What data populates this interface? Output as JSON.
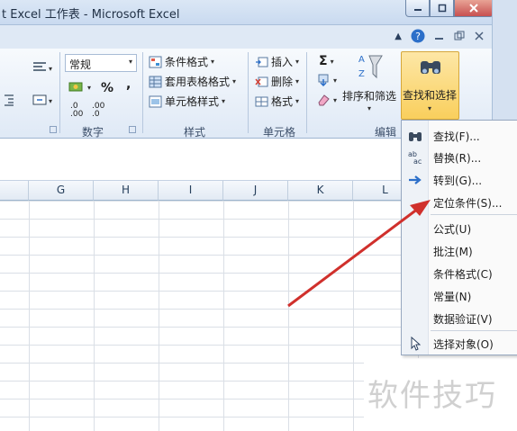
{
  "window": {
    "title": "t Excel 工作表 - Microsoft Excel"
  },
  "ribbon": {
    "number_format": "常规",
    "percent_symbol": "%",
    "comma_symbol": ",",
    "decimal_increase": ".0 .00",
    "decimal_decrease": ".00 .0",
    "groups": {
      "number": "数字",
      "styles": "样式",
      "cells": "单元格",
      "editing": "编辑"
    },
    "styles": {
      "conditional_format": "条件格式",
      "table_format": "套用表格格式",
      "cell_styles": "单元格样式"
    },
    "cells": {
      "insert": "插入",
      "delete": "删除",
      "format": "格式"
    },
    "editing": {
      "autosum": "Σ",
      "sort_filter": "排序和筛选",
      "find_select": "查找和选择"
    }
  },
  "sheet": {
    "columns": [
      "G",
      "H",
      "I",
      "J",
      "K",
      "L"
    ]
  },
  "menu": {
    "items": [
      {
        "label": "查找(F)...",
        "icon": "binoculars-icon"
      },
      {
        "label": "替换(R)...",
        "icon": "replace-icon"
      },
      {
        "label": "转到(G)...",
        "icon": "arrow-right-icon"
      },
      {
        "label": "定位条件(S)...",
        "icon": ""
      },
      {
        "label": "公式(U)",
        "icon": ""
      },
      {
        "label": "批注(M)",
        "icon": ""
      },
      {
        "label": "条件格式(C)",
        "icon": ""
      },
      {
        "label": "常量(N)",
        "icon": ""
      },
      {
        "label": "数据验证(V)",
        "icon": ""
      },
      {
        "label": "选择对象(O)",
        "icon": "cursor-icon"
      }
    ]
  },
  "watermark": "软件技巧",
  "colors": {
    "highlight_button": "#f9cf5d",
    "annotation_arrow": "#d0302c"
  }
}
